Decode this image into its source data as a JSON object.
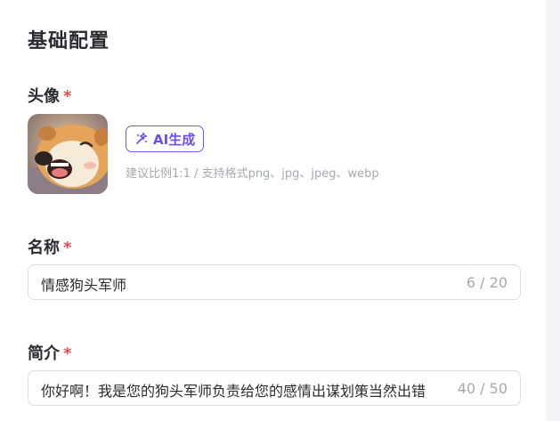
{
  "section": {
    "title": "基础配置"
  },
  "avatar": {
    "label": "头像",
    "required_mark": "*",
    "ai_button_label": "AI生成",
    "hint": "建议比例1:1 / 支持格式png、jpg、jpeg、webp"
  },
  "name": {
    "label": "名称",
    "required_mark": "*",
    "value": "情感狗头军师",
    "counter": "6 / 20"
  },
  "intro": {
    "label": "简介",
    "required_mark": "*",
    "value": "你好啊！我是您的狗头军师负责给您的感情出谋划策当然出错",
    "counter": "40 / 50"
  },
  "colors": {
    "required": "#f0494d",
    "ai_accent": "#6b4cf5",
    "hint": "#a8a8b0"
  },
  "icons": {
    "ai": "magic-wand-icon"
  }
}
